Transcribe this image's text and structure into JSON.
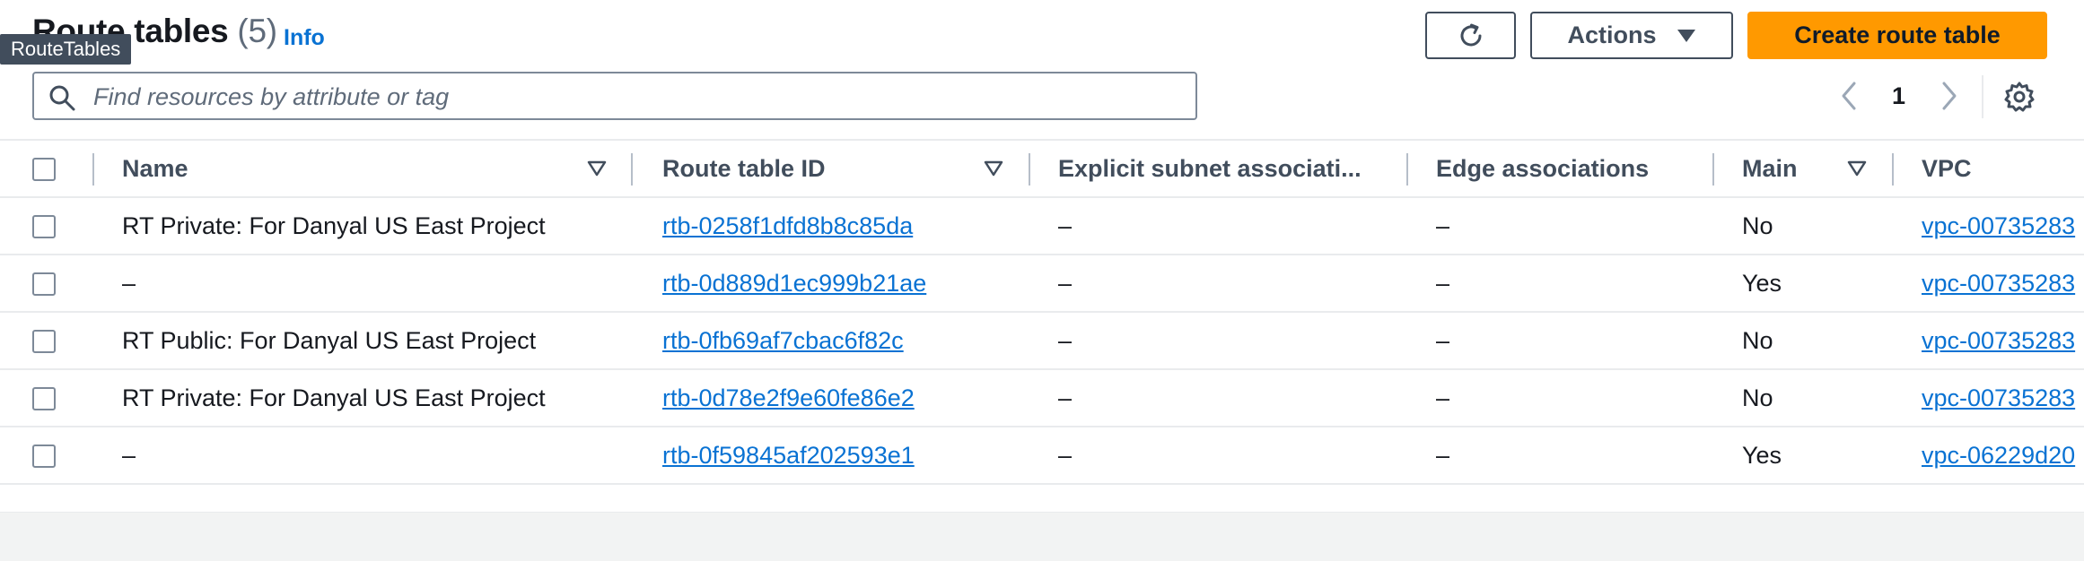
{
  "header": {
    "title": "Route tables",
    "count": "(5)",
    "info": "Info",
    "tooltip": "RouteTables"
  },
  "toolbar": {
    "refresh_icon": "refresh-icon",
    "actions_label": "Actions",
    "create_label": "Create route table"
  },
  "search": {
    "placeholder": "Find resources by attribute or tag",
    "value": ""
  },
  "pagination": {
    "current_page": "1"
  },
  "table": {
    "columns": [
      {
        "label": "Name",
        "sortable": true
      },
      {
        "label": "Route table ID",
        "sortable": true
      },
      {
        "label": "Explicit subnet associati...",
        "sortable": false
      },
      {
        "label": "Edge associations",
        "sortable": false
      },
      {
        "label": "Main",
        "sortable": true
      },
      {
        "label": "VPC",
        "sortable": false
      }
    ],
    "rows": [
      {
        "name": "RT Private: For Danyal US East Project",
        "id": "rtb-0258f1dfd8b8c85da",
        "subnet": "–",
        "edge": "–",
        "main": "No",
        "vpc": "vpc-00735283"
      },
      {
        "name": "–",
        "id": "rtb-0d889d1ec999b21ae",
        "subnet": "–",
        "edge": "–",
        "main": "Yes",
        "vpc": "vpc-00735283"
      },
      {
        "name": "RT Public: For Danyal US East Project",
        "id": "rtb-0fb69af7cbac6f82c",
        "subnet": "–",
        "edge": "–",
        "main": "No",
        "vpc": "vpc-00735283"
      },
      {
        "name": "RT Private: For Danyal US East Project",
        "id": "rtb-0d78e2f9e60fe86e2",
        "subnet": "–",
        "edge": "–",
        "main": "No",
        "vpc": "vpc-00735283"
      },
      {
        "name": "–",
        "id": "rtb-0f59845af202593e1",
        "subnet": "–",
        "edge": "–",
        "main": "Yes",
        "vpc": "vpc-06229d20"
      }
    ]
  },
  "colors": {
    "primary": "#ff9900",
    "link": "#0972d3",
    "text": "#16191f",
    "border": "#7d8998"
  }
}
